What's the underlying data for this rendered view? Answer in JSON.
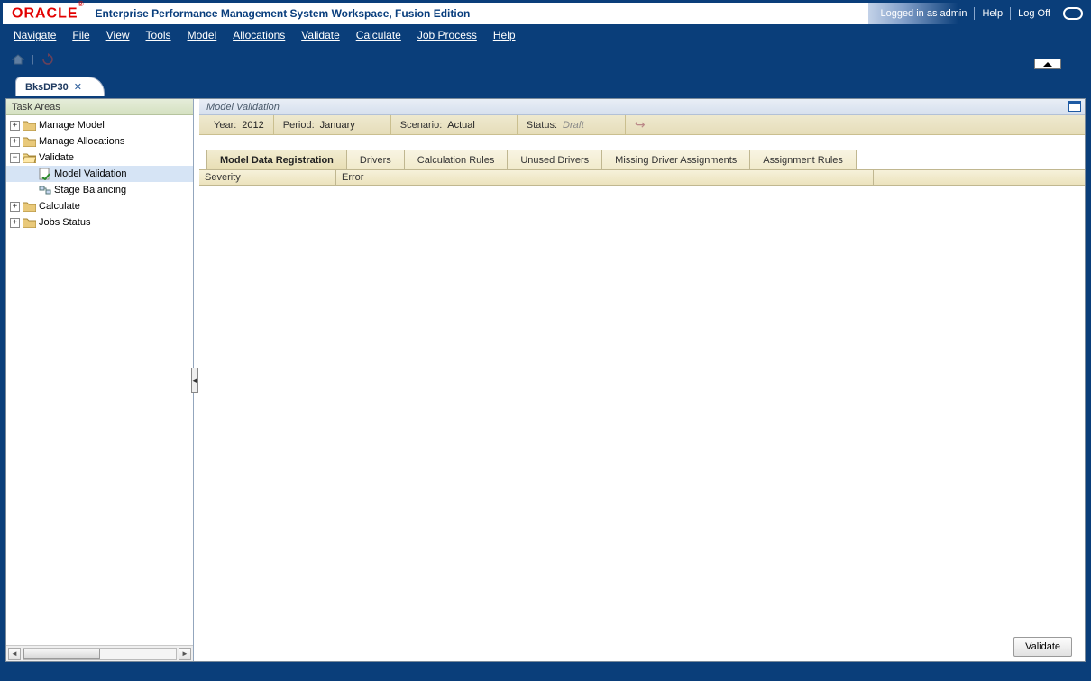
{
  "header": {
    "logo_text": "ORACLE",
    "app_title": "Enterprise Performance Management System Workspace, Fusion Edition",
    "logged_in_text": "Logged in as admin",
    "help_label": "Help",
    "logoff_label": "Log Off"
  },
  "menu": {
    "items": [
      "Navigate",
      "File",
      "View",
      "Tools",
      "Model",
      "Allocations",
      "Validate",
      "Calculate",
      "Job Process",
      "Help"
    ]
  },
  "doc_tab": {
    "label": "BksDP30",
    "close": "✕"
  },
  "sidebar": {
    "title": "Task Areas",
    "items": [
      {
        "label": "Manage Model",
        "expander": "+",
        "icon": "folder"
      },
      {
        "label": "Manage Allocations",
        "expander": "+",
        "icon": "folder"
      },
      {
        "label": "Validate",
        "expander": "−",
        "icon": "folder"
      },
      {
        "label": "Model Validation",
        "expander": "",
        "icon": "check",
        "indent": 1,
        "selected": true
      },
      {
        "label": "Stage Balancing",
        "expander": "",
        "icon": "stage",
        "indent": 1
      },
      {
        "label": "Calculate",
        "expander": "+",
        "icon": "folder"
      },
      {
        "label": "Jobs Status",
        "expander": "+",
        "icon": "folder"
      }
    ]
  },
  "panel": {
    "title": "Model Validation"
  },
  "pov": {
    "year_label": "Year:",
    "year_value": "2012",
    "period_label": "Period:",
    "period_value": "January",
    "scenario_label": "Scenario:",
    "scenario_value": "Actual",
    "status_label": "Status:",
    "status_value": "Draft"
  },
  "tabs": [
    "Model Data Registration",
    "Drivers",
    "Calculation Rules",
    "Unused Drivers",
    "Missing Driver Assignments",
    "Assignment Rules"
  ],
  "grid": {
    "columns": {
      "severity": "Severity",
      "error": "Error"
    }
  },
  "buttons": {
    "validate": "Validate"
  }
}
